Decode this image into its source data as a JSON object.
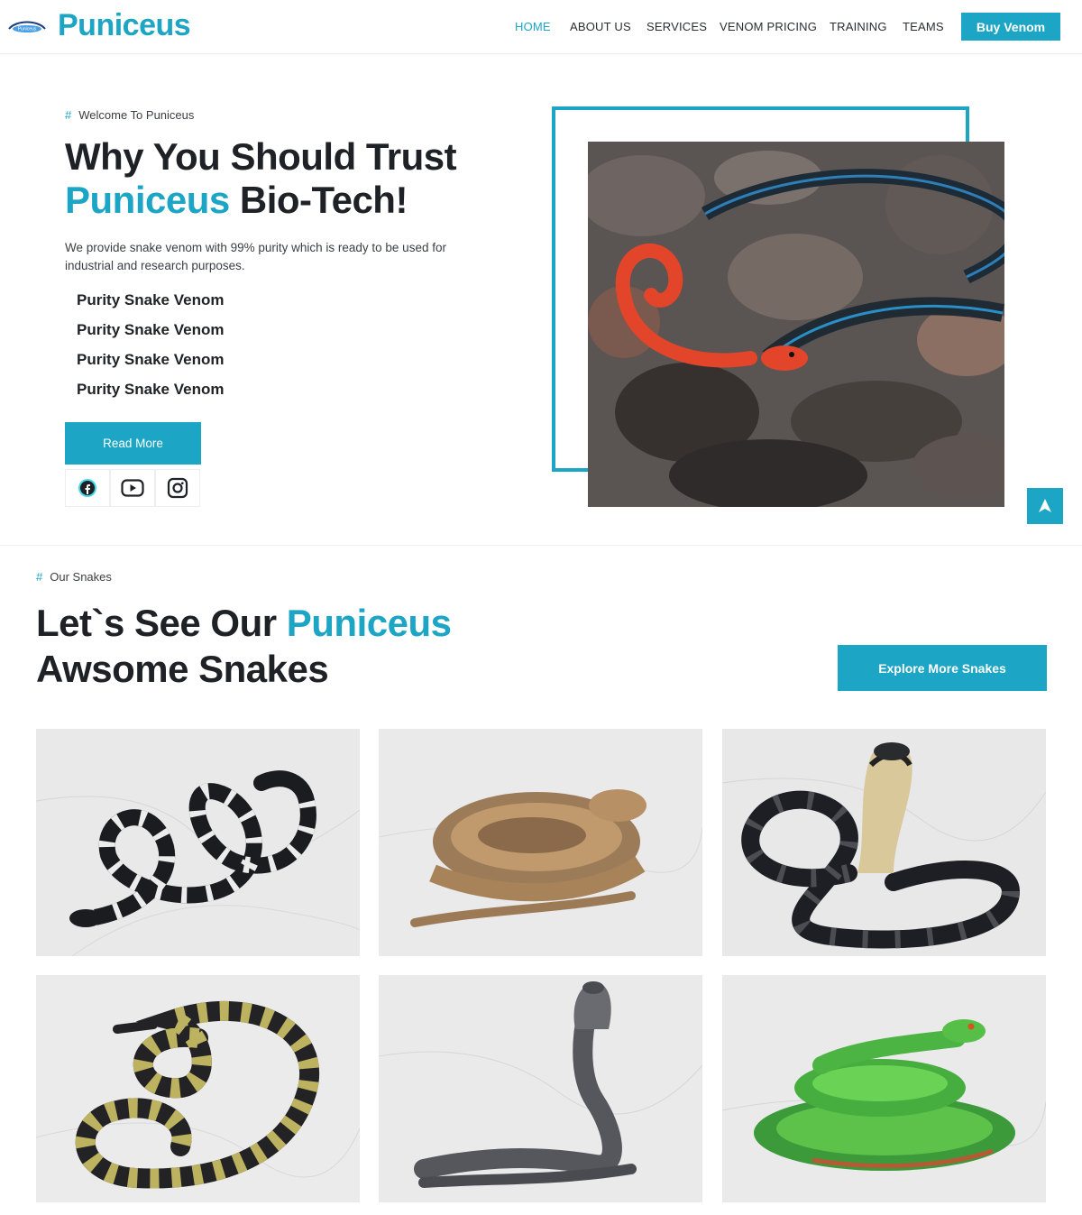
{
  "header": {
    "logo_text": "Puniceus",
    "logo_mark_text": "Puniceus",
    "nav": [
      "HOME",
      "ABOUT US",
      "SERVICES",
      "VENOM PRICING",
      "TRAINING",
      "TEAMS"
    ],
    "buy_label": "Buy Venom"
  },
  "hero": {
    "tag": "Welcome To Puniceus",
    "title_line1": "Why You Should Trust",
    "title_accent": "Puniceus",
    "title_rest": "Bio-Tech!",
    "description": "We provide snake venom with 99% purity which is ready to be used for industrial and research purposes.",
    "features": [
      "Purity Snake Venom",
      "Purity Snake Venom",
      "Purity Snake Venom",
      "Purity Snake Venom"
    ],
    "read_more": "Read More",
    "social": [
      "facebook-icon",
      "youtube-icon",
      "instagram-icon"
    ]
  },
  "snakes": {
    "tag": "Our Snakes",
    "title_prefix": "Let`s See Our",
    "title_accent": "Puniceus",
    "title_line2": "Awsome Snakes",
    "explore": "Explore More Snakes"
  },
  "hash_symbol": "#",
  "colors": {
    "accent": "#1ca5c4",
    "text": "#1e2226"
  }
}
